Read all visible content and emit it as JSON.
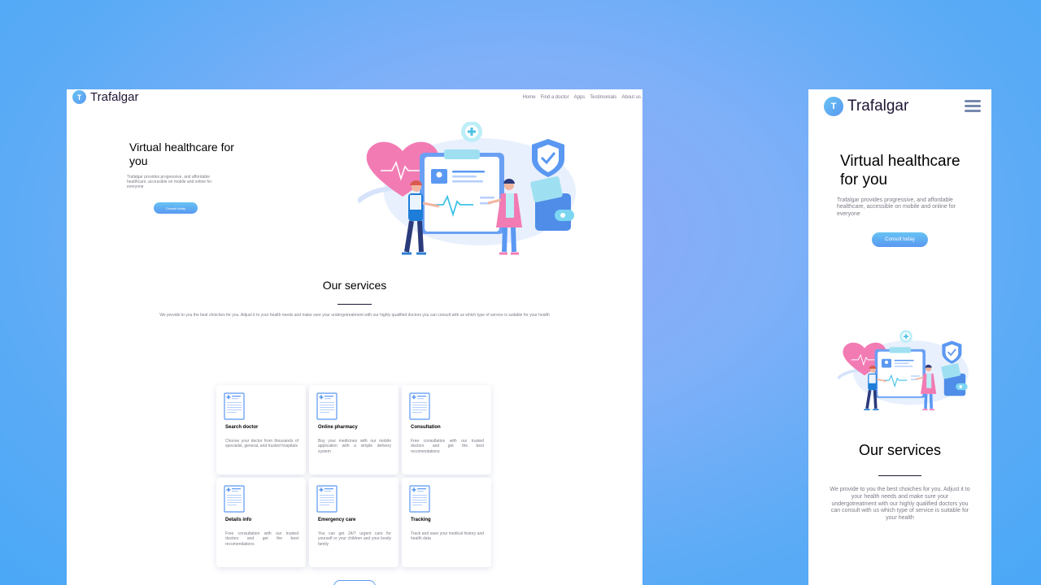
{
  "brand": {
    "initial": "T",
    "name": "Trafalgar",
    "colors": {
      "primary": "#5a98f2",
      "secondary": "#67c3f3",
      "heading": "#1f1534",
      "text": "#7d7987",
      "heart": "#f27bb4"
    }
  },
  "nav": [
    "Home",
    "Find a doctor",
    "Apps",
    "Testimonials",
    "About us"
  ],
  "hero": {
    "title": "Virtual healthcare for you",
    "text": "Trafalgar provides progressive, and affordable healthcare, accessible on mobile and online for everyone",
    "cta": "Consult today"
  },
  "services": {
    "title": "Our services",
    "text": "We provide to you the best choiches for you. Adjust it to your health needs and make sure your undergotreatment with our highly qualified doctors you can consult with us which type of service is suitable for your health",
    "items": [
      {
        "title": "Search doctor",
        "text": "Choose your doctor from thousands of specialist, general, and trusted hospitals"
      },
      {
        "title": "Online pharmacy",
        "text": "Buy your medicines with our mobile application with a simple delivery system"
      },
      {
        "title": "Consultation",
        "text": "Free consultation with our trusted doctors and get the best recomendations"
      },
      {
        "title": "Details info",
        "text": "Free consultation with our trusted doctors and get the best recomendations"
      },
      {
        "title": "Emergency care",
        "text": "You can get 24/7 urgent care for yourself or your children and your lovely family"
      },
      {
        "title": "Tracking",
        "text": "Track and save your medical history and health data"
      }
    ]
  },
  "illustration": {
    "icon": "doctor-clipboard-heart-illustration"
  }
}
